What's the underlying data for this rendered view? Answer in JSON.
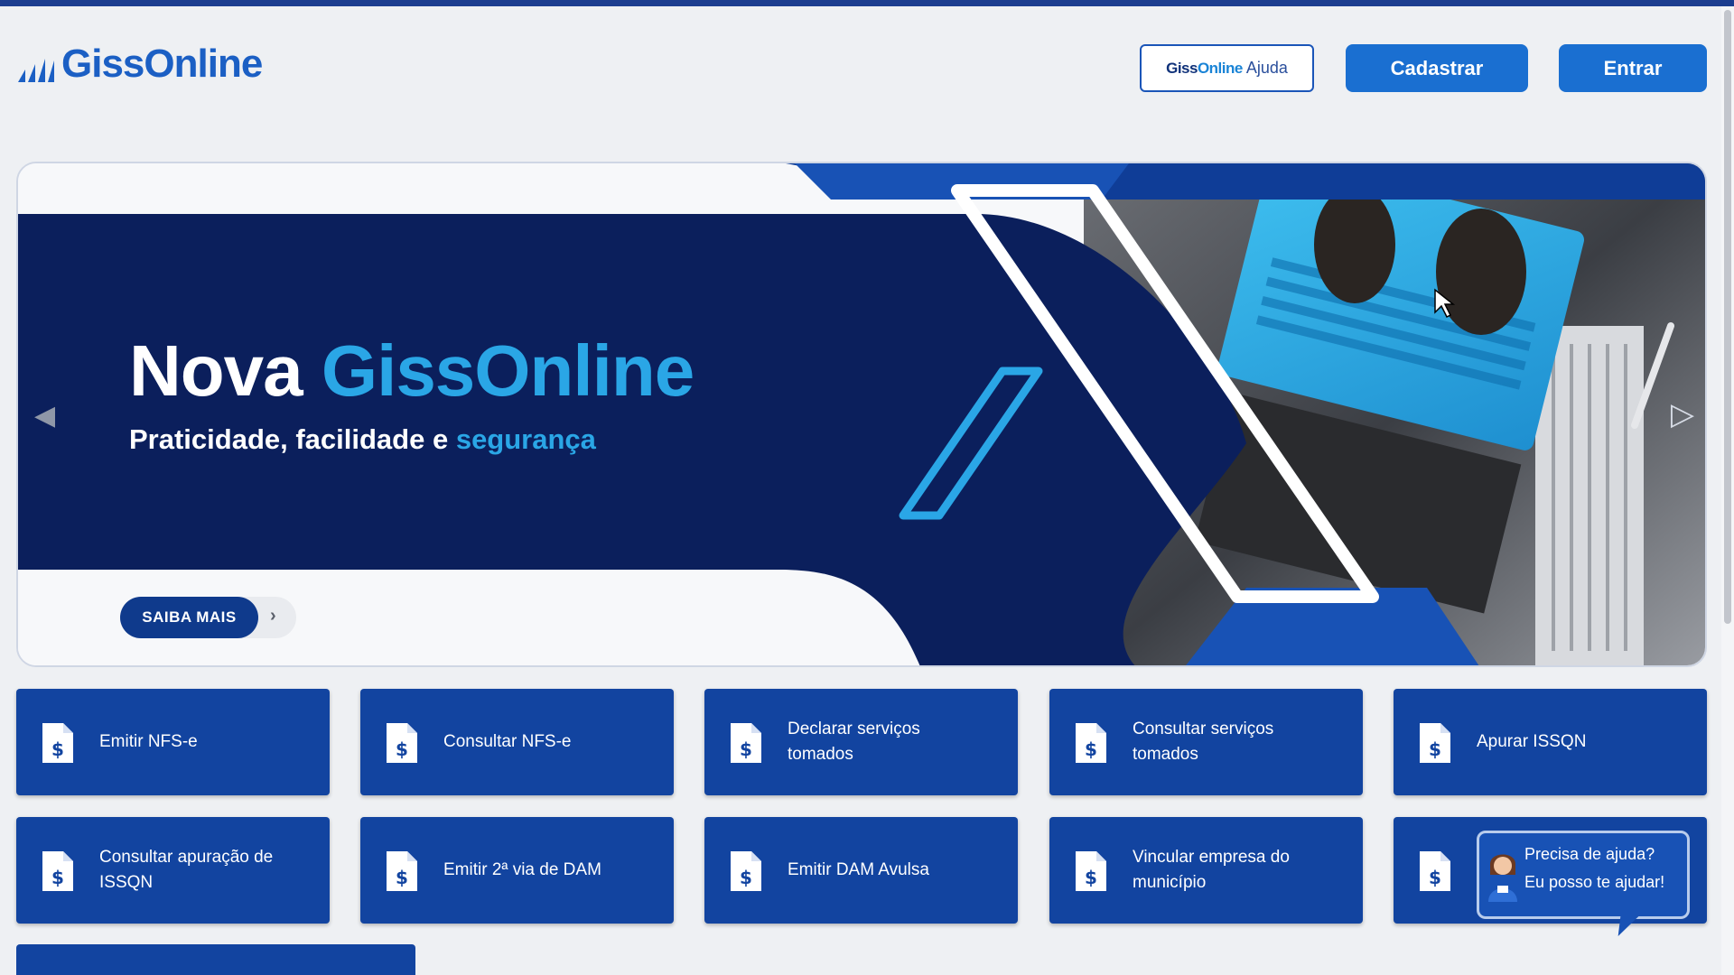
{
  "header": {
    "logo_text": "GissOnline",
    "help_button": {
      "brand_a": "Giss",
      "brand_b": "Online",
      "label": "Ajuda"
    },
    "register_label": "Cadastrar",
    "login_label": "Entrar"
  },
  "banner": {
    "title_plain": "Nova",
    "title_accent": "GissOnline",
    "subtitle_plain": "Praticidade, facilidade e",
    "subtitle_accent": "segurança",
    "cta_label": "SAIBA MAIS"
  },
  "services": [
    {
      "label": "Emitir NFS-e"
    },
    {
      "label": "Consultar NFS-e"
    },
    {
      "label": "Declarar serviços tomados"
    },
    {
      "label": "Consultar serviços tomados"
    },
    {
      "label": "Apurar ISSQN"
    },
    {
      "label": "Consultar apuração de ISSQN"
    },
    {
      "label": "Emitir 2ª via de DAM"
    },
    {
      "label": "Emitir DAM Avulsa"
    },
    {
      "label": "Vincular empresa do município"
    },
    {
      "label": ""
    }
  ],
  "chat_widget": {
    "line1": "Precisa de ajuda?",
    "line2": "Eu posso te ajudar!"
  },
  "colors": {
    "primary": "#1a6fd1",
    "tile": "#1244a0",
    "banner_navy": "#0b1f5c",
    "accent_cyan": "#2aa6e6"
  }
}
